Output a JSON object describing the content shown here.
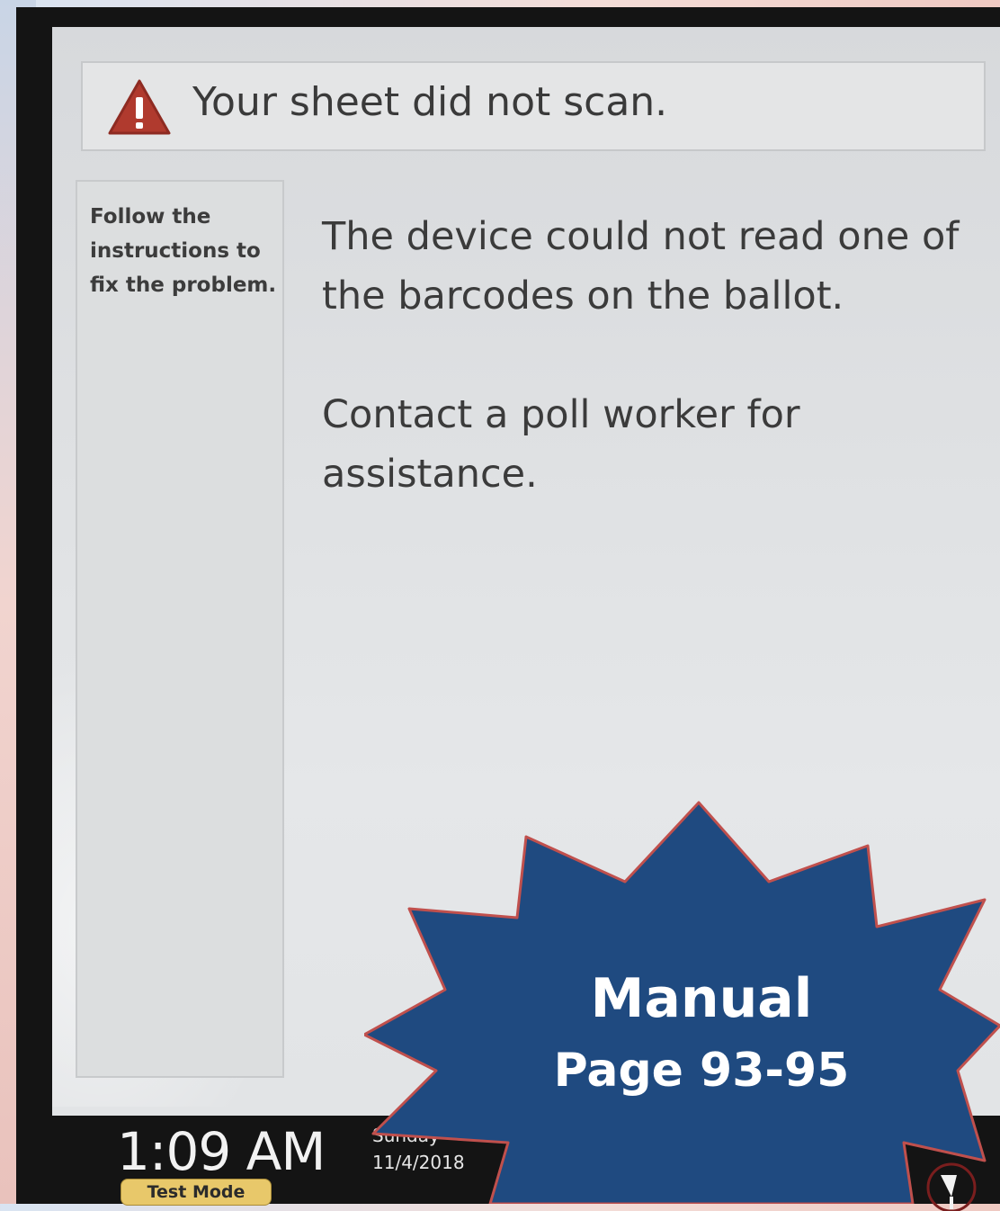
{
  "screen": {
    "banner": {
      "title": "Your sheet did not scan."
    },
    "side_panel": {
      "instruction": "Follow the instructions to fix the problem."
    },
    "main": {
      "message_1": "The device could not read one of the barcodes on the ballot.",
      "message_2": "Contact a poll worker for assistance."
    }
  },
  "status_bar": {
    "time": "1:09 AM",
    "day": "Sunday",
    "date": "11/4/2018",
    "mode_badge": "Test Mode"
  },
  "callout": {
    "line1": "Manual",
    "line2": "Page 93-95",
    "fill_color": "#1f4a80",
    "border_color": "#c0504d"
  },
  "colors": {
    "warning_icon": "#b03a2e"
  },
  "icons": {
    "banner": "warning-triangle-icon",
    "status": "pen-icon"
  }
}
